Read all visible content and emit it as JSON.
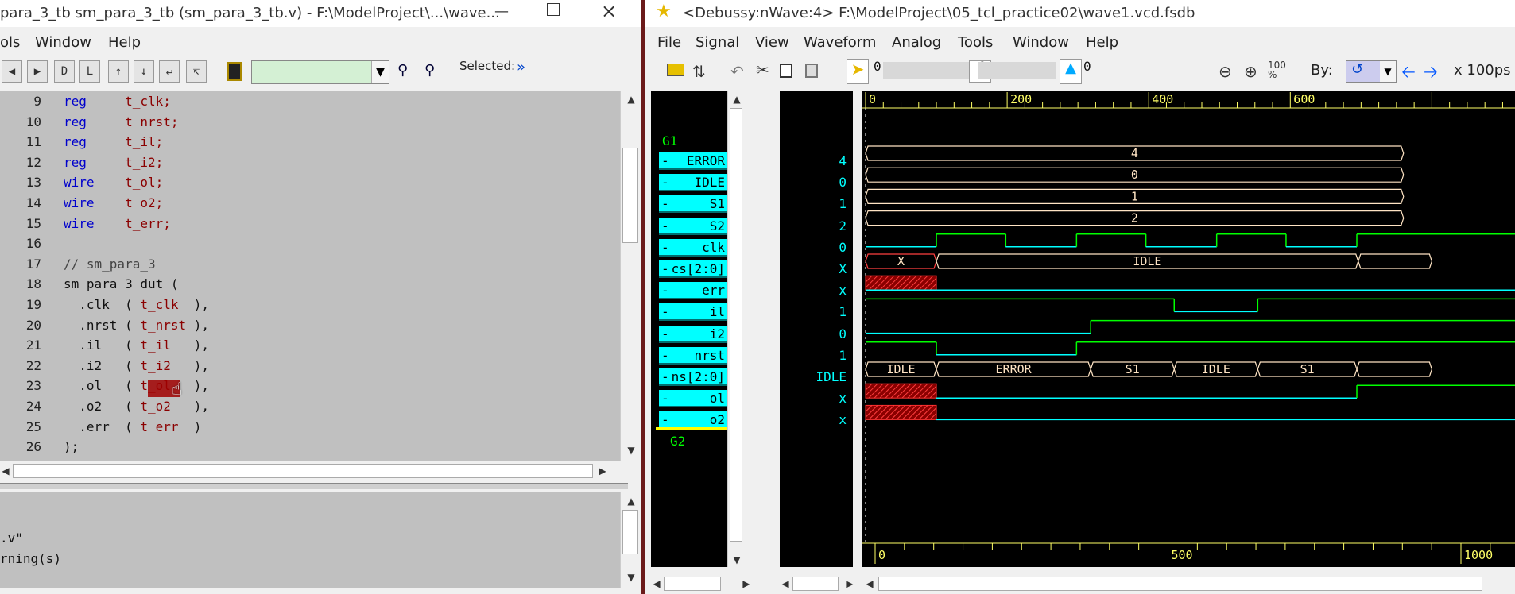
{
  "left": {
    "title": "para_3_tb sm_para_3_tb (sm_para_3_tb.v) - F:\\ModelProject\\...\\wave...",
    "menu": [
      "ols",
      "Window",
      "Help"
    ],
    "selected_label": "Selected:",
    "code_lines": [
      {
        "n": "9",
        "kw": "reg",
        "rest": "     t_clk;"
      },
      {
        "n": "10",
        "kw": "reg",
        "rest": "     t_nrst;"
      },
      {
        "n": "11",
        "kw": "reg",
        "rest": "     t_il;"
      },
      {
        "n": "12",
        "kw": "reg",
        "rest": "     t_i2;"
      },
      {
        "n": "13",
        "kw": "wire",
        "rest": "    t_ol;"
      },
      {
        "n": "14",
        "kw": "wire",
        "rest": "    t_o2;"
      },
      {
        "n": "15",
        "kw": "wire",
        "rest": "    t_err;"
      },
      {
        "n": "16",
        "kw": "",
        "rest": ""
      },
      {
        "n": "17",
        "kw": "",
        "rest": "// sm_para_3"
      },
      {
        "n": "18",
        "kw": "",
        "rest": "sm_para_3 dut ("
      },
      {
        "n": "19",
        "kw": "",
        "rest": "  .clk  ( t_clk  ),"
      },
      {
        "n": "20",
        "kw": "",
        "rest": "  .nrst ( t_nrst ),"
      },
      {
        "n": "21",
        "kw": "",
        "rest": "  .il   ( t_il   ),"
      },
      {
        "n": "22",
        "kw": "",
        "rest": "  .i2   ( t_i2   ),"
      },
      {
        "n": "23",
        "kw": "",
        "rest": "  .ol   ( t_ol   ),"
      },
      {
        "n": "24",
        "kw": "",
        "rest": "  .o2   ( t_o2   ),"
      },
      {
        "n": "25",
        "kw": "",
        "rest": "  .err  ( t_err  )"
      },
      {
        "n": "26",
        "kw": "",
        "rest": ");"
      }
    ],
    "output_lines": [
      ".v\"",
      "rning(s)"
    ]
  },
  "right": {
    "title": "<Debussy:nWave:4> F:\\ModelProject\\05_tcl_practice02\\wave1.vcd.fsdb",
    "menu": [
      "File",
      "Signal",
      "View",
      "Waveform",
      "Analog",
      "Tools",
      "Window",
      "Help"
    ],
    "cursor_values": [
      "0",
      "0",
      "0"
    ],
    "by_label": "By:",
    "time_unit": "x 100ps",
    "groups": [
      "G1",
      "G2"
    ],
    "signals": [
      {
        "name": "ERROR",
        "value": "4"
      },
      {
        "name": "IDLE",
        "value": "0"
      },
      {
        "name": "S1",
        "value": "1"
      },
      {
        "name": "S2",
        "value": "2"
      },
      {
        "name": "clk",
        "value": "0"
      },
      {
        "name": "cs[2:0]",
        "value": "X"
      },
      {
        "name": "err",
        "value": "x"
      },
      {
        "name": "il",
        "value": "1"
      },
      {
        "name": "i2",
        "value": "0"
      },
      {
        "name": "nrst",
        "value": "1"
      },
      {
        "name": "ns[2:0]",
        "value": "IDLE"
      },
      {
        "name": "ol",
        "value": "x"
      },
      {
        "name": "o2",
        "value": "x"
      }
    ],
    "top_ruler": [
      "0",
      "200",
      "400",
      "600"
    ],
    "bottom_ruler": [
      "0",
      "500",
      "1000"
    ],
    "bus_labels": {
      "error": "4",
      "idle": "0",
      "s1": "1",
      "s2": "2",
      "cs": [
        "X",
        "IDLE"
      ],
      "ns": [
        "IDLE",
        "ERROR",
        "S1",
        "IDLE",
        "S1"
      ]
    }
  },
  "colors": {
    "waveform_bg": "#000000",
    "signal_cyan": "#00ffff",
    "clock_green": "#00ff00",
    "bus_tan": "#ffe4c4",
    "keyword_blue": "#0000cc",
    "ident_darkred": "#8b0000"
  }
}
